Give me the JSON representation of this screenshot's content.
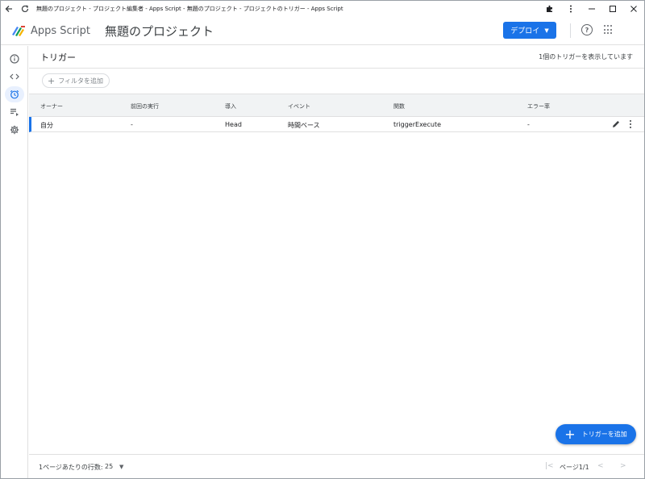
{
  "browser": {
    "title": "無題のプロジェクト - プロジェクト編集者 - Apps Script - 無題のプロジェクト - プロジェクトのトリガー - Apps Script"
  },
  "header": {
    "brand": "Apps Script",
    "project_title": "無題のプロジェクト",
    "deploy_label": "デプロイ"
  },
  "page": {
    "title": "トリガー",
    "count_text": "1個のトリガーを表示しています",
    "filter_label": "フィルタを追加"
  },
  "table": {
    "columns": [
      "オーナー",
      "前回の実行",
      "導入",
      "イベント",
      "関数",
      "エラー率"
    ],
    "rows": [
      {
        "owner": "自分",
        "last_run": "-",
        "deployment": "Head",
        "event": "時間ベース",
        "function": "triggerExecute",
        "error_rate": "-"
      }
    ]
  },
  "fab": {
    "label": "トリガーを追加"
  },
  "footer": {
    "rows_per_page_label": "1ページあたりの行数:",
    "rows_per_page_value": "25",
    "page_text": "ページ1/1"
  },
  "colors": {
    "accent": "#1a73e8",
    "header_bg": "#f1f3f4"
  }
}
